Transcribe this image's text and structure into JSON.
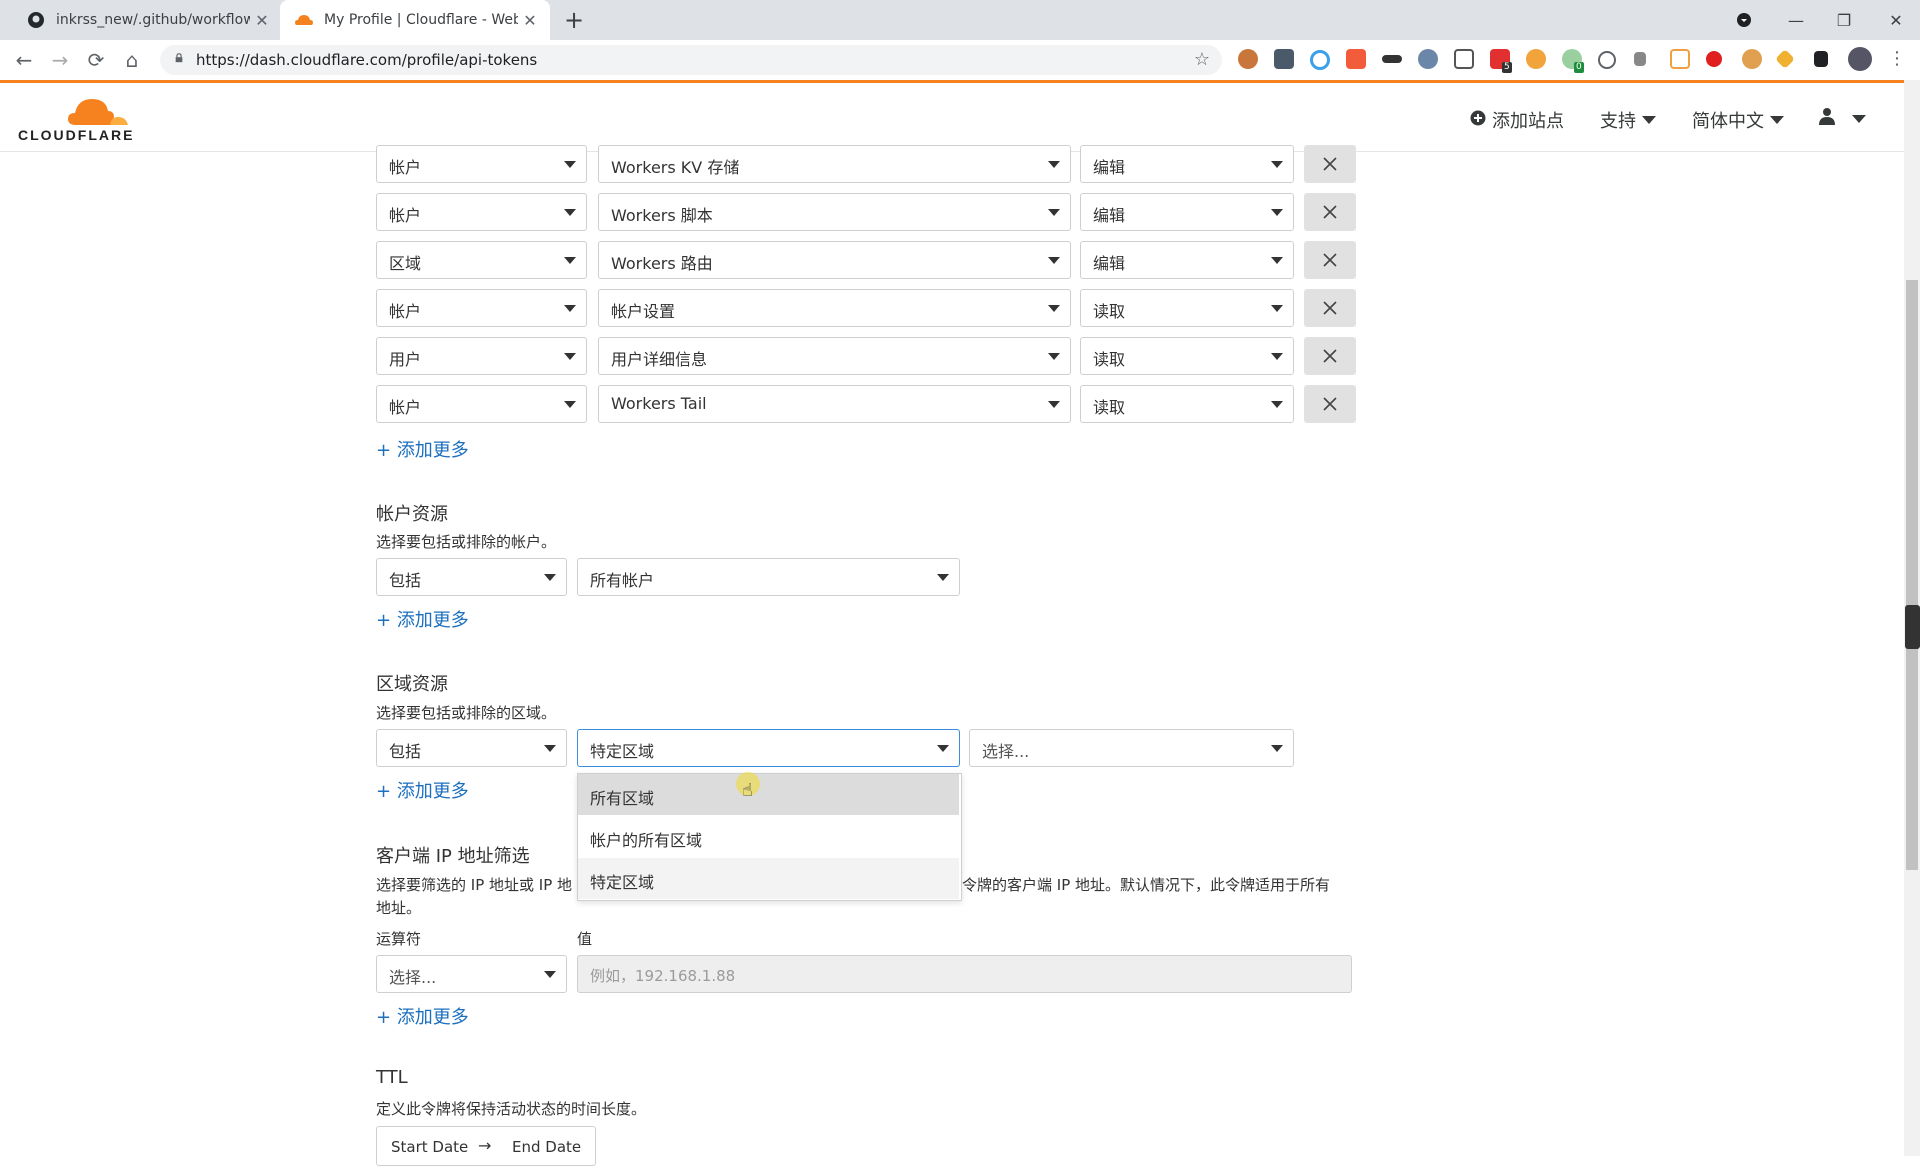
{
  "browser": {
    "tabs": [
      {
        "title": "inkrss_new/.github/workflows",
        "icon": "github-icon",
        "active": false
      },
      {
        "title": "My Profile | Cloudflare - Web P",
        "icon": "cloudflare-icon",
        "active": true
      }
    ],
    "url": "https://dash.cloudflare.com/profile/api-tokens",
    "extension_badges": {
      "badge_a": "5",
      "badge_b": "0"
    }
  },
  "header": {
    "logo_text": "CLOUDFLARE",
    "add_site": "添加站点",
    "support": "支持",
    "language": "简体中文"
  },
  "permissions": {
    "rows": [
      {
        "scope": "帐户",
        "resource": "Workers KV 存储",
        "level": "编辑"
      },
      {
        "scope": "帐户",
        "resource": "Workers 脚本",
        "level": "编辑"
      },
      {
        "scope": "区域",
        "resource": "Workers 路由",
        "level": "编辑"
      },
      {
        "scope": "帐户",
        "resource": "帐户设置",
        "level": "读取"
      },
      {
        "scope": "用户",
        "resource": "用户详细信息",
        "level": "读取"
      },
      {
        "scope": "帐户",
        "resource": "Workers Tail",
        "level": "读取"
      }
    ],
    "add_more": "添加更多"
  },
  "account_resources": {
    "title": "帐户资源",
    "desc": "选择要包括或排除的帐户。",
    "include": "包括",
    "target": "所有帐户",
    "add_more": "添加更多"
  },
  "zone_resources": {
    "title": "区域资源",
    "desc": "选择要包括或排除的区域。",
    "include": "包括",
    "target": "特定区域",
    "select_placeholder": "选择...",
    "add_more": "添加更多",
    "menu_options": [
      "所有区域",
      "帐户的所有区域",
      "特定区域"
    ]
  },
  "ip_filter": {
    "title": "客户端 IP 地址筛选",
    "desc_left": "选择要筛选的 IP 地址或 IP 地",
    "desc_right": "令牌的客户端 IP 地址。默认情况下，此令牌适用于所有",
    "desc_line2": "地址。",
    "operator_label": "运算符",
    "value_label": "值",
    "operator_placeholder": "选择...",
    "value_placeholder": "例如，192.168.1.88",
    "add_more": "添加更多"
  },
  "ttl": {
    "title": "TTL",
    "desc": "定义此令牌将保持活动状态的时间长度。",
    "start": "Start Date",
    "arrow": "→",
    "end": "End Date"
  },
  "colors": {
    "accent": "#f6821f",
    "link": "#1b6fbf",
    "focus": "#3a8ddc"
  }
}
